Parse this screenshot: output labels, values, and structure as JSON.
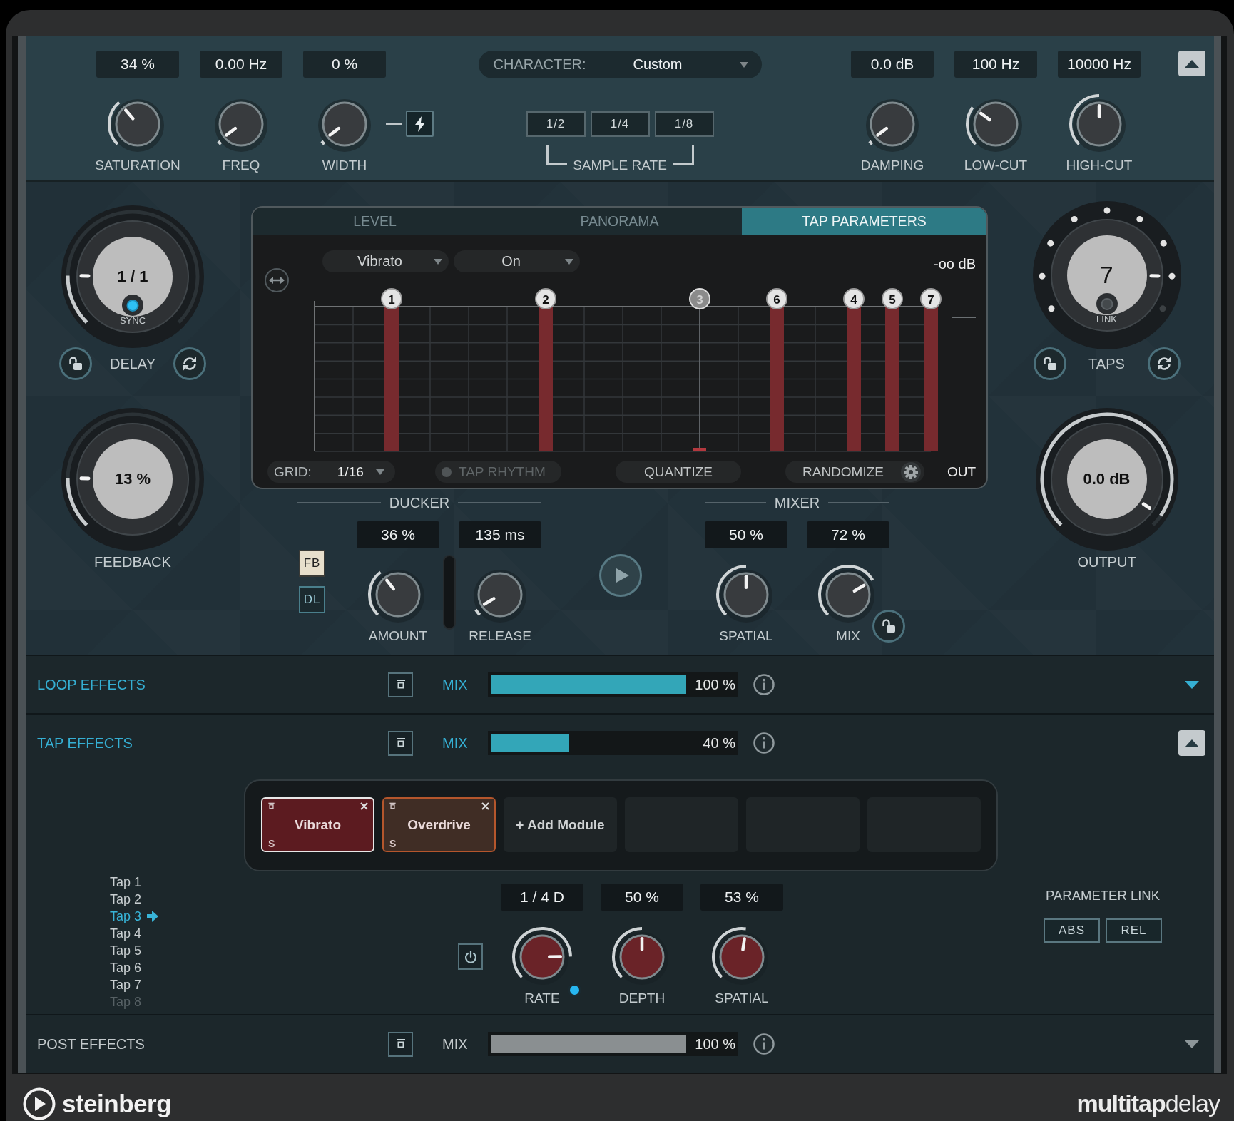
{
  "top_panel": {
    "knobs_left": [
      {
        "label": "SATURATION",
        "value": "34 %",
        "level": 0.35
      },
      {
        "label": "FREQ",
        "value": "0.00 Hz",
        "level": 0.03
      },
      {
        "label": "WIDTH",
        "value": "0 %",
        "level": 0.03
      }
    ],
    "character": {
      "label": "CHARACTER:",
      "value": "Custom"
    },
    "sample_rate": {
      "label": "SAMPLE RATE",
      "options": [
        {
          "label": "1/2",
          "selected": false
        },
        {
          "label": "1/4",
          "selected": false
        },
        {
          "label": "1/8",
          "selected": false
        }
      ]
    },
    "knobs_right": [
      {
        "label": "DAMPING",
        "value": "0.0 dB",
        "level": 0.03
      },
      {
        "label": "LOW-CUT",
        "value": "100 Hz",
        "level": 0.3
      },
      {
        "label": "HIGH-CUT",
        "value": "10000 Hz",
        "level": 0.5
      }
    ],
    "expanded": true
  },
  "delay": {
    "label": "DELAY",
    "value": "1 / 1",
    "level": 0.17,
    "sync": {
      "label": "SYNC",
      "on": true
    }
  },
  "feedback": {
    "label": "FEEDBACK",
    "value": "13 %",
    "level": 0.17
  },
  "display": {
    "tabs": [
      {
        "label": "LEVEL",
        "selected": false
      },
      {
        "label": "PANORAMA",
        "selected": false
      },
      {
        "label": "TAP PARAMETERS",
        "selected": true
      }
    ],
    "parameter": "Vibrato",
    "setting": "On",
    "out_reading": "-oo dB",
    "taps": [
      {
        "label": "1",
        "selected": false,
        "on": true
      },
      {
        "label": "2",
        "selected": false,
        "on": true
      },
      {
        "label": "3",
        "selected": true,
        "on": false
      },
      {
        "label": "6",
        "selected": false,
        "on": true
      },
      {
        "label": "4",
        "selected": false,
        "on": true
      },
      {
        "label": "5",
        "selected": false,
        "on": true
      },
      {
        "label": "7",
        "selected": false,
        "on": true
      }
    ],
    "grid": {
      "label": "GRID:",
      "value": "1/16"
    },
    "tap_rhythm": {
      "label": "TAP RHYTHM",
      "on": false
    },
    "quantize": "QUANTIZE",
    "randomize": "RANDOMIZE",
    "out_label": "OUT"
  },
  "ducker": {
    "title": "DUCKER",
    "sources": [
      {
        "label": "FB",
        "selected": true
      },
      {
        "label": "DL",
        "selected": false
      }
    ],
    "knobs": [
      {
        "label": "AMOUNT",
        "value": "36 %",
        "level": 0.36
      },
      {
        "label": "RELEASE",
        "value": "135 ms",
        "level": 0.05
      }
    ]
  },
  "mixer": {
    "title": "MIXER",
    "knobs": [
      {
        "label": "SPATIAL",
        "value": "50 %",
        "level": 0.5
      },
      {
        "label": "MIX",
        "value": "72 %",
        "level": 0.72
      }
    ]
  },
  "taps": {
    "label": "TAPS",
    "value": "7",
    "level": 0.875,
    "link": {
      "label": "LINK",
      "on": false
    }
  },
  "output": {
    "label": "OUTPUT",
    "value": "0.0 dB",
    "level": 0.96
  },
  "effect_sections": [
    {
      "title": "LOOP EFFECTS",
      "active": true,
      "expanded": false,
      "mix": {
        "label": "MIX",
        "level": 1,
        "reading": "100 %"
      }
    },
    {
      "title": "TAP EFFECTS",
      "active": true,
      "expanded": true,
      "mix": {
        "label": "MIX",
        "level": 0.4,
        "reading": "40 %"
      },
      "modules": [
        {
          "kind": "effect",
          "name": "Vibrato",
          "solo": "S",
          "color": "#5c1b20",
          "selected": true
        },
        {
          "kind": "effect",
          "name": "Overdrive",
          "solo": "S",
          "color": "#b5562c",
          "selected": false
        },
        {
          "kind": "add",
          "label": "+ Add Module"
        },
        {
          "kind": "empty"
        },
        {
          "kind": "empty"
        },
        {
          "kind": "empty"
        }
      ],
      "taps": [
        {
          "label": "Tap 1",
          "selected": false,
          "disabled": false
        },
        {
          "label": "Tap 2",
          "selected": false,
          "disabled": false
        },
        {
          "label": "Tap 3",
          "selected": true,
          "disabled": false
        },
        {
          "label": "Tap 4",
          "selected": false,
          "disabled": false
        },
        {
          "label": "Tap 5",
          "selected": false,
          "disabled": false
        },
        {
          "label": "Tap 6",
          "selected": false,
          "disabled": false
        },
        {
          "label": "Tap 7",
          "selected": false,
          "disabled": false
        },
        {
          "label": "Tap 8",
          "selected": false,
          "disabled": true
        }
      ],
      "power": {
        "on": false
      },
      "controls": [
        {
          "label": "RATE",
          "value": "1 / 4 D",
          "level": 0.83,
          "sync": true
        },
        {
          "label": "DEPTH",
          "value": "50 %",
          "level": 0.5
        },
        {
          "label": "SPATIAL",
          "value": "53 %",
          "level": 0.53
        }
      ],
      "parameter_link": {
        "label": "PARAMETER LINK",
        "options": [
          {
            "label": "ABS",
            "selected": false
          },
          {
            "label": "REL",
            "selected": false
          }
        ]
      }
    },
    {
      "title": "POST EFFECTS",
      "active": false,
      "expanded": false,
      "mix": {
        "label": "MIX",
        "level": 1,
        "reading": "100 %"
      }
    }
  ],
  "footer": {
    "brand": "steinberg",
    "product": "**multitap**delay"
  }
}
